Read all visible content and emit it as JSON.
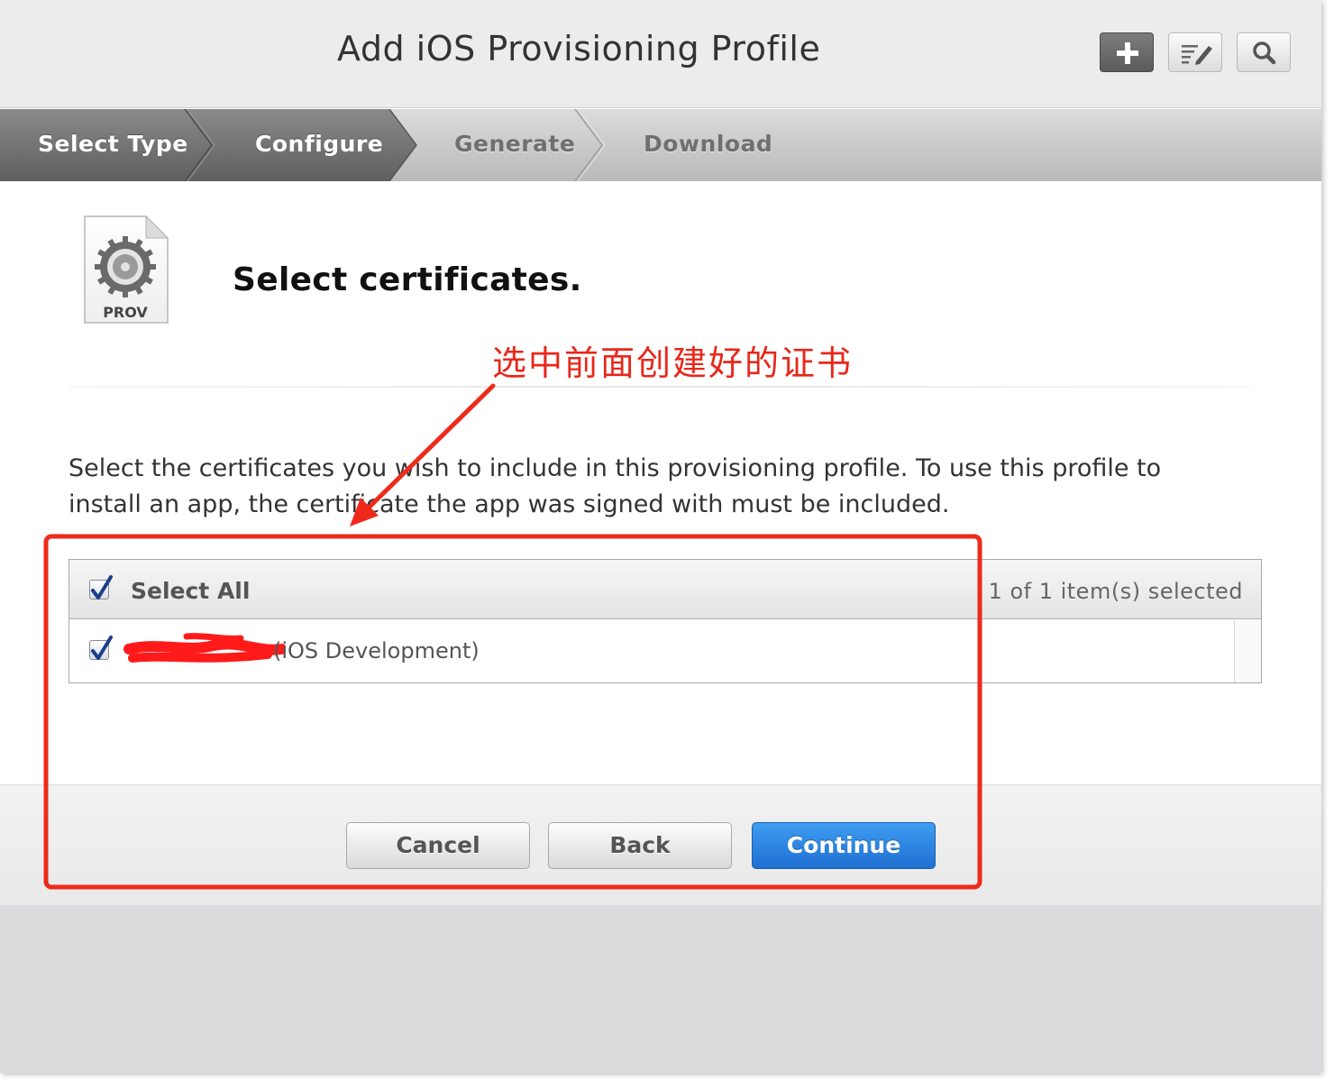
{
  "header": {
    "title": "Add iOS Provisioning Profile",
    "buttons": [
      {
        "icon": "plus-icon"
      },
      {
        "icon": "edit-list-icon"
      },
      {
        "icon": "search-icon"
      }
    ]
  },
  "steps": [
    {
      "label": "Select Type",
      "state": "done"
    },
    {
      "label": "Configure",
      "state": "active"
    },
    {
      "label": "Generate",
      "state": "pending"
    },
    {
      "label": "Download",
      "state": "pending"
    }
  ],
  "icon_label": "PROV",
  "section_heading": "Select certificates.",
  "annotation": {
    "text": "选中前面创建好的证书",
    "color": "#e8271a"
  },
  "description": "Select the certificates you wish to include in this provisioning profile. To use this profile to install an app, the certificate the app was signed with must be included.",
  "certificates": {
    "select_all_label": "Select All",
    "select_all_checked": true,
    "selection_count": "1 of 1 item(s) selected",
    "items": [
      {
        "label": "(iOS Development)",
        "checked": true,
        "name_redacted": true
      }
    ]
  },
  "footer": {
    "cancel_label": "Cancel",
    "back_label": "Back",
    "continue_label": "Continue"
  },
  "colors": {
    "primary_button": "#1f6fd1",
    "active_step": "#6e6e6e"
  }
}
